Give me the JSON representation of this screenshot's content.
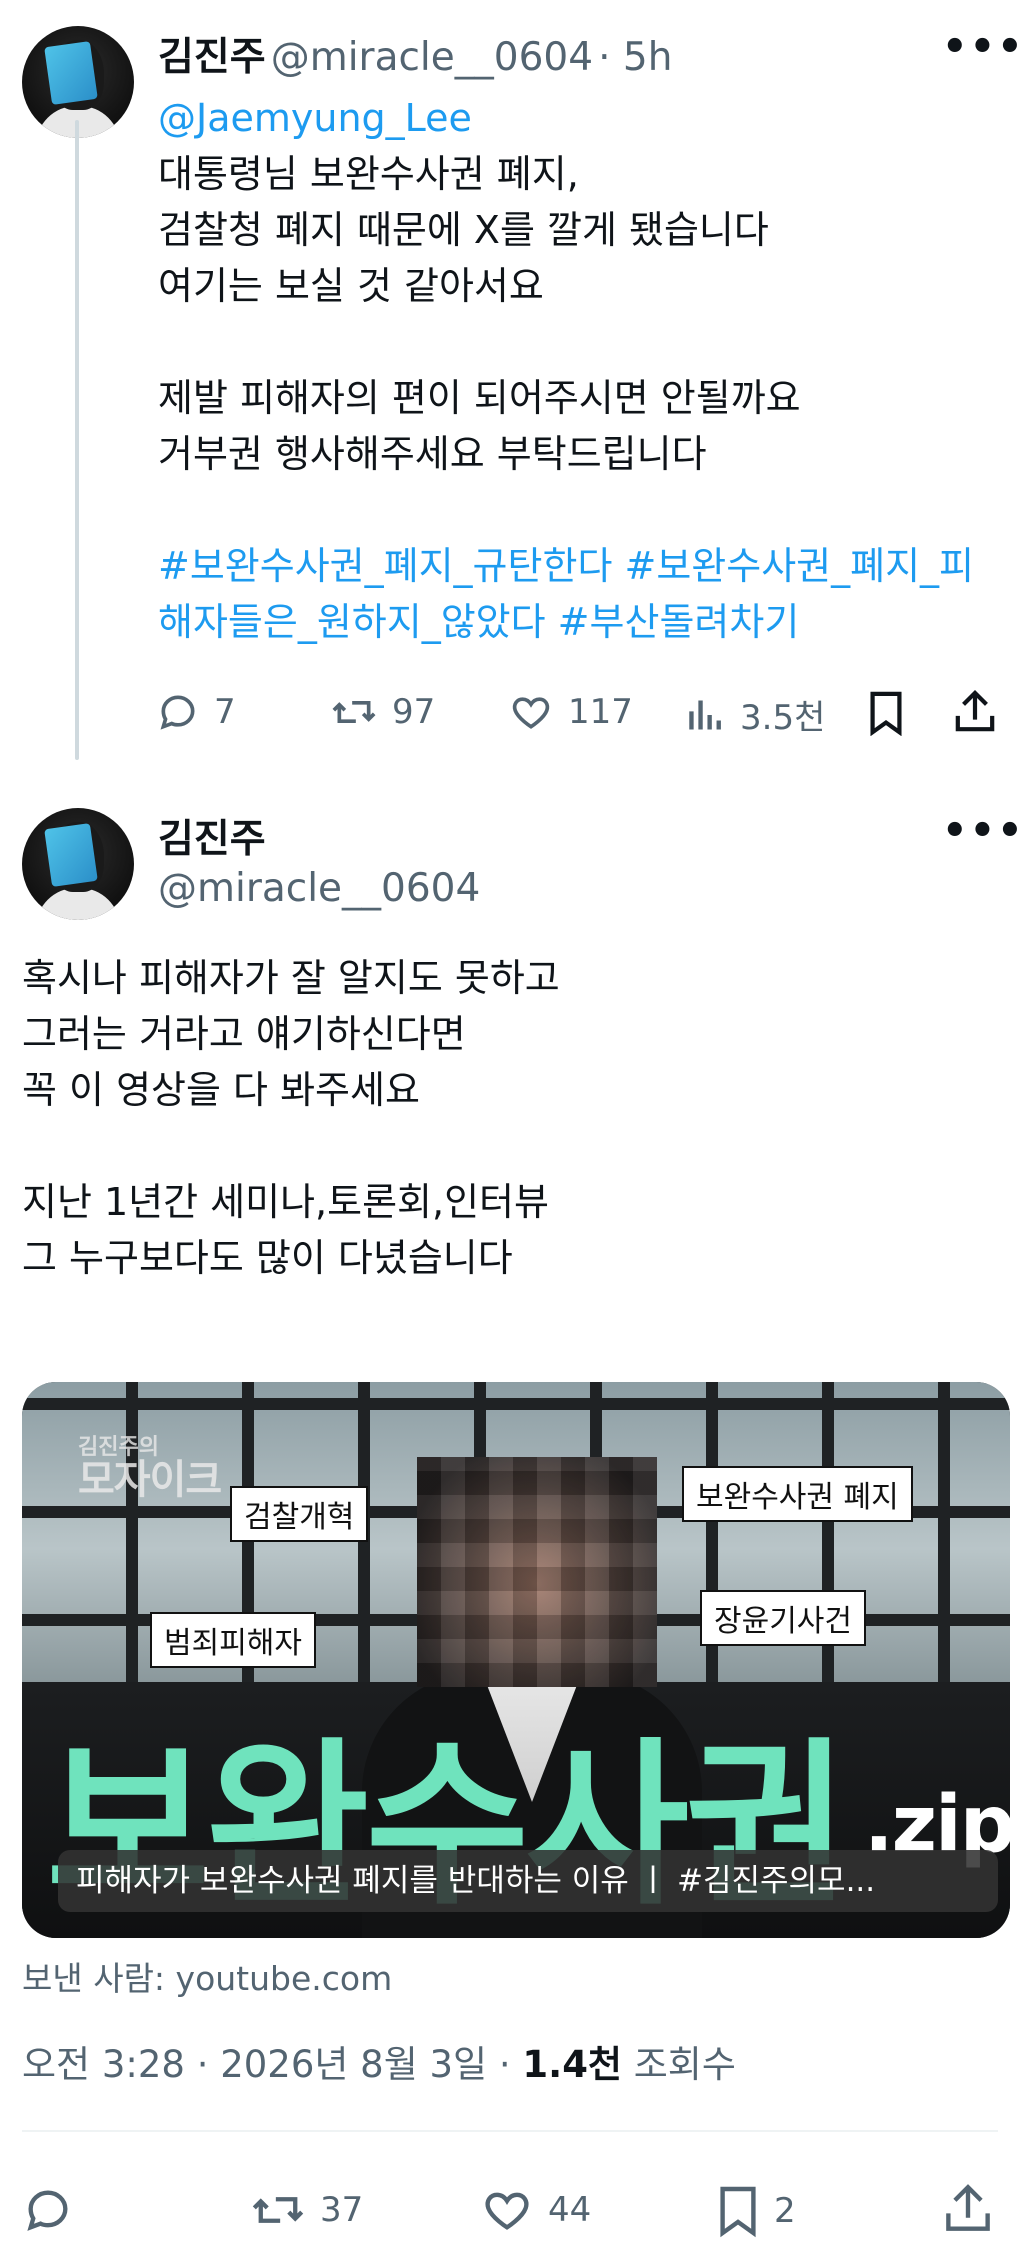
{
  "reply_tweet": {
    "author_name": "김진주",
    "author_handle": "@miracle__0604",
    "time": "· 5h",
    "more_label": "•••",
    "mention": "@Jaemyung_Lee",
    "lines": [
      "대통령님 보완수사권 폐지,",
      "검찰청 폐지 때문에 X를 깔게 됐습니다",
      "여기는 보실 것 같아서요",
      "",
      "제발 피해자의 편이 되어주시면 안될까요",
      "거부권 행사해주세요 부탁드립니다",
      ""
    ],
    "hashtags_line1": "#보완수사권_폐지_규탄한다 #보완수사권_폐지_피",
    "hashtags_line2": "해자들은_원하지_않았다 #부산돌려차기",
    "actions": {
      "replies": "7",
      "reposts": "97",
      "likes": "117",
      "views": "3.5천"
    },
    "icons": [
      "reply-icon",
      "repost-icon",
      "like-icon",
      "views-icon",
      "bookmark-icon",
      "share-icon"
    ]
  },
  "main_tweet": {
    "author_name": "김진주",
    "author_handle": "@miracle__0604",
    "more_label": "•••",
    "lines": [
      "혹시나 피해자가 잘 알지도 못하고",
      "그러는 거라고 얘기하신다면",
      "꼭 이 영상을 다 봐주세요",
      "",
      "지난 1년간 세미나,토론회,인터뷰",
      "그 누구보다도 많이 다녔습니다"
    ],
    "card": {
      "brand_small": "김진주의",
      "brand_big": "모자이크",
      "tags": {
        "tag_prosecution": "검찰개혁",
        "tag_abolish": "보완수사권 폐지",
        "tag_victim": "범죄피해자",
        "tag_case": "장윤기사건"
      },
      "big_title": "보완수사권",
      "zip_label": ".zip",
      "caption": "피해자가 보완수사권 폐지를 반대하는 이유 ㅣ #김진주의모..."
    },
    "from": "보낸 사람: youtube.com",
    "meta": {
      "time": "오전 3:28 · 2026년 8월 3일 · ",
      "views_count": "1.4천",
      "views_label": " 조회수"
    },
    "actions": {
      "reposts": "37",
      "likes": "44",
      "bookmarks": "2"
    },
    "colors": {
      "accent": "#1d9bf0",
      "secondary_text": "#536471",
      "title_green": "#6fe3bd"
    }
  }
}
